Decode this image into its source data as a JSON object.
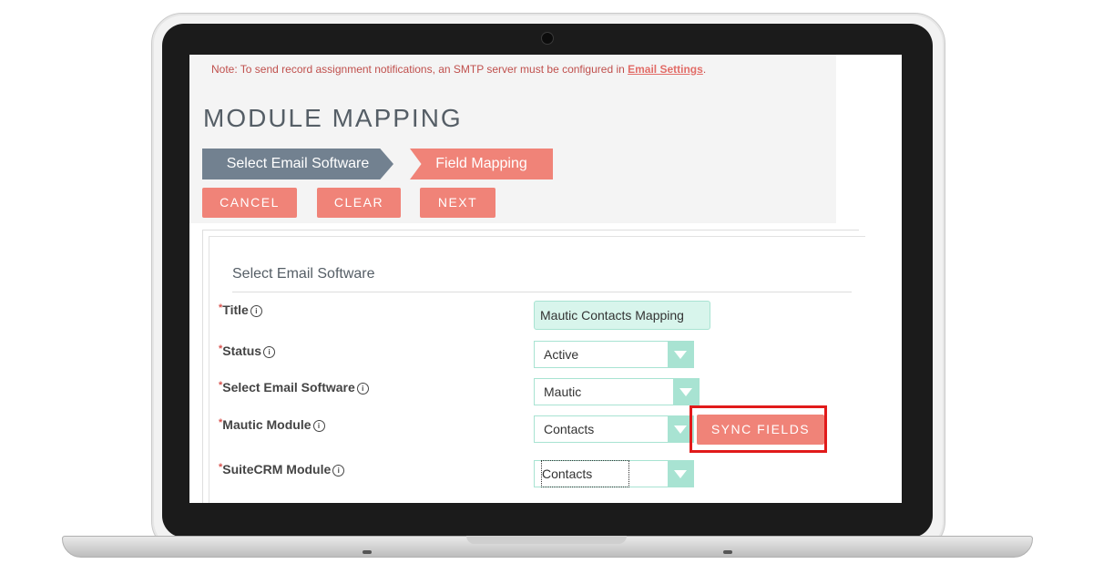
{
  "notice": {
    "text": "Note: To send record assignment notifications, an SMTP server must be configured in ",
    "link_text": "Email Settings",
    "suffix": "."
  },
  "page": {
    "title": "MODULE MAPPING"
  },
  "steps": [
    {
      "label": "Select Email Software"
    },
    {
      "label": "Field Mapping"
    }
  ],
  "actions": {
    "cancel": "CANCEL",
    "clear": "CLEAR",
    "next": "NEXT"
  },
  "section": {
    "title": "Select Email Software"
  },
  "fields": {
    "title": {
      "label": "Title",
      "value": "Mautic Contacts Mapping"
    },
    "status": {
      "label": "Status",
      "value": "Active"
    },
    "software": {
      "label": "Select Email Software",
      "value": "Mautic"
    },
    "mautic_module": {
      "label": "Mautic Module",
      "value": "Contacts"
    },
    "suite_module": {
      "label": "SuiteCRM Module",
      "value": "Contacts"
    }
  },
  "sync": {
    "label": "SYNC FIELDS"
  },
  "symbols": {
    "required": "*",
    "info": "i"
  },
  "colors": {
    "accent": "#f08378",
    "step_active": "#728190",
    "field_border": "#a8e3d2",
    "highlight": "#e11a1a"
  }
}
